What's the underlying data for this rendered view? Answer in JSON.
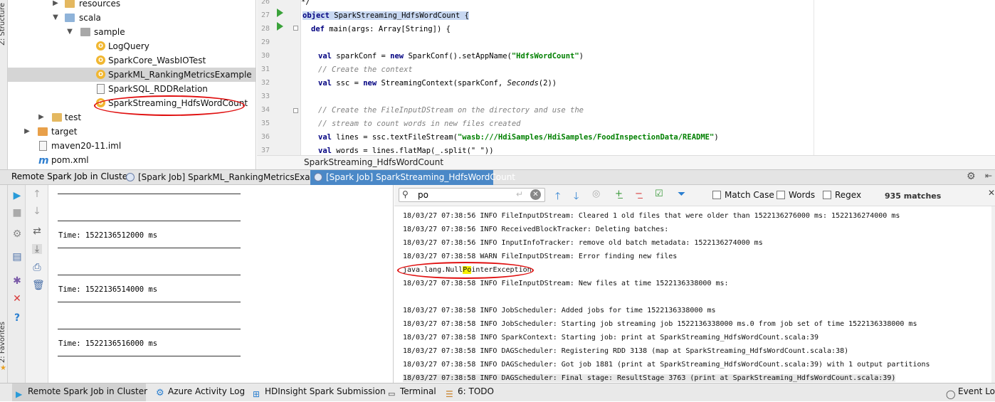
{
  "sidebar": {
    "structure_label": "Z: Structure",
    "favorites_label": "2: Favorites"
  },
  "project_tree": {
    "items": [
      {
        "label": "resources",
        "type": "folder"
      },
      {
        "label": "scala",
        "type": "folder"
      },
      {
        "label": "sample",
        "type": "package"
      },
      {
        "label": "LogQuery",
        "type": "object"
      },
      {
        "label": "SparkCore_WasbIOTest",
        "type": "object"
      },
      {
        "label": "SparkML_RankingMetricsExample",
        "type": "object",
        "selected": true
      },
      {
        "label": "SparkSQL_RDDRelation",
        "type": "file"
      },
      {
        "label": "SparkStreaming_HdfsWordCount",
        "type": "object"
      },
      {
        "label": "test",
        "type": "folder"
      },
      {
        "label": "target",
        "type": "folder"
      },
      {
        "label": "maven20-11.iml",
        "type": "file"
      },
      {
        "label": "pom.xml",
        "type": "maven"
      }
    ]
  },
  "editor": {
    "line_numbers": [
      "26",
      "27",
      "28",
      "29",
      "30",
      "31",
      "32",
      "33",
      "34",
      "35",
      "36",
      "37"
    ],
    "lines": [
      {
        "kw": "",
        "rest": "*/"
      },
      {
        "kw": "object",
        "rest": " SparkStreaming_HdfsWordCount {"
      },
      {
        "kw": "def",
        "rest": " main(args: Array[String]) {"
      },
      {
        "kw": "",
        "rest": ""
      },
      {
        "kw": "val",
        "rest": " sparkConf = ",
        "kw2": "new",
        "rest2": " SparkConf().setAppName(",
        "str": "\"HdfsWordCount\"",
        "rest3": ")"
      },
      {
        "comment": "// Create the context"
      },
      {
        "kw": "val",
        "rest": " ssc = ",
        "kw2": "new",
        "rest2": " StreamingContext(sparkConf, ",
        "it": "Seconds",
        "rest3": "(2))"
      },
      {
        "kw": "",
        "rest": ""
      },
      {
        "comment": "// Create the FileInputDStream on the directory and use the"
      },
      {
        "comment": "// stream to count words in new files created"
      },
      {
        "kw": "val",
        "rest": " lines = ssc.textFileStream(",
        "str": "\"wasb:///HdiSamples/HdiSamples/FoodInspectionData/README\"",
        "rest3": ")"
      },
      {
        "kw": "val",
        "rest": " words = lines.flatMap(_.split(\" \"))"
      }
    ],
    "breadcrumb": "SparkStreaming_HdfsWordCount"
  },
  "run_panel": {
    "title": "Remote Spark Job in Cluster:",
    "tabs": [
      {
        "label": "[Spark Job] SparkML_RankingMetricsExample",
        "active": false
      },
      {
        "label": "[Spark Job] SparkStreaming_HdfsWordCount",
        "active": true
      }
    ]
  },
  "left_console": {
    "times": [
      "Time: 1522136512000 ms",
      "Time: 1522136514000 ms",
      "Time: 1522136516000 ms"
    ]
  },
  "search": {
    "query": "po",
    "match_case": "Match Case",
    "words": "Words",
    "regex": "Regex",
    "matches": "935 matches"
  },
  "log_lines": [
    "18/03/27 07:38:56 INFO FileInputDStream: Cleared 1 old files that were older than 1522136276000 ms: 1522136274000 ms",
    "18/03/27 07:38:56 INFO ReceivedBlockTracker: Deleting batches:",
    "18/03/27 07:38:56 INFO InputInfoTracker: remove old batch metadata: 1522136274000 ms",
    "18/03/27 07:38:58 WARN FileInputDStream: Error finding new files",
    "java.lang.NullPointerException",
    "18/03/27 07:38:58 INFO FileInputDStream: New files at time 1522136338000 ms:",
    "",
    "18/03/27 07:38:58 INFO JobScheduler: Added jobs for time 1522136338000 ms",
    "18/03/27 07:38:58 INFO JobScheduler: Starting job streaming job 1522136338000 ms.0 from job set of time 1522136338000 ms",
    "18/03/27 07:38:58 INFO SparkContext: Starting job: print at SparkStreaming_HdfsWordCount.scala:39",
    "18/03/27 07:38:58 INFO DAGScheduler: Registering RDD 3138 (map at SparkStreaming_HdfsWordCount.scala:38)",
    "18/03/27 07:38:58 INFO DAGScheduler: Got job 1881 (print at SparkStreaming_HdfsWordCount.scala:39) with 1 output partitions",
    "18/03/27 07:38:58 INFO DAGScheduler: Final stage: ResultStage 3763 (print at SparkStreaming_HdfsWordCount.scala:39)"
  ],
  "npe": {
    "before": "java.lang.Null",
    "hit": "Po",
    "after": "interException"
  },
  "status_bar": {
    "tabs": [
      {
        "label": "Remote Spark Job in Cluster",
        "active": true
      },
      {
        "label": "Azure Activity Log"
      },
      {
        "label": "HDInsight Spark Submission"
      },
      {
        "label": "Terminal"
      },
      {
        "label": "6: TODO"
      }
    ],
    "event_log": "Event Log"
  },
  "colors": {
    "accent": "#4a88c7",
    "annotation": "#e01010",
    "highlight": "#f7f000"
  }
}
